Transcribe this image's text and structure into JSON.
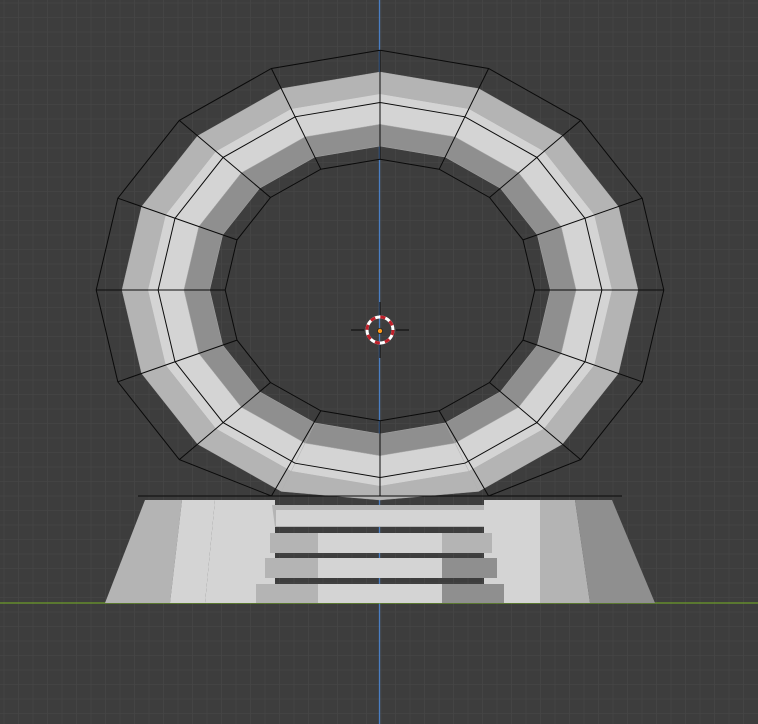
{
  "viewport": {
    "background_color": "#3d3d3d",
    "grid_minor_color": "#464646",
    "grid_major_color": "#4d4d4d",
    "x_axis_color": "#6d9b2a",
    "z_axis_color": "#4a7fc4",
    "cage_wire_color": "#0a0a0a",
    "mesh_light_color": "#d4d4d4",
    "mesh_mid_color": "#b4b4b4",
    "mesh_dark_color": "#8f8f8f",
    "cursor_ring_red": "#c0202a",
    "cursor_ring_white": "#ffffff",
    "origin_color": "#ff9a1a"
  },
  "objects": {
    "ring_arch": {
      "type": "torus-arch",
      "segments": 16
    },
    "subdivision_cage": {
      "type": "wireframe-cage"
    },
    "base_platform": {
      "type": "trapezoid-base"
    },
    "stairs": {
      "step_count": 4
    },
    "cursor_3d": {
      "icon": "3d-cursor-icon"
    },
    "object_origin": {
      "icon": "origin-dot"
    }
  }
}
